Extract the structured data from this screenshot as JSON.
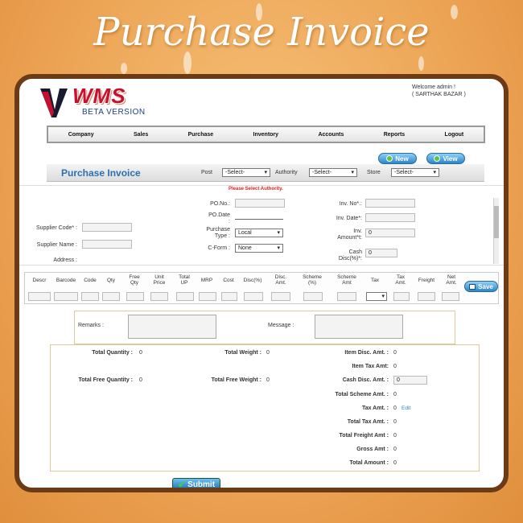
{
  "banner": {
    "title": "Purchase Invoice"
  },
  "header": {
    "logo_text": "WMS",
    "logo_sub": "BETA VERSION",
    "welcome_line1": "Welcome admin !",
    "welcome_line2": "( SARTHAK BAZAR )"
  },
  "nav": [
    "Company",
    "Sales",
    "Purchase",
    "Inventory",
    "Accounts",
    "Reports",
    "Logout"
  ],
  "toolbar": {
    "new_label": "New",
    "view_label": "View"
  },
  "filters": {
    "page_title": "Purchase Invoice",
    "post_label": "Post",
    "post_value": "-Select-",
    "authority_label": "Authority",
    "authority_value": "-Select-",
    "store_label": "Store",
    "store_value": "-Select-"
  },
  "form": {
    "warning": "Please Select Authority.",
    "supplier_code_label": "Supplier Code* :",
    "supplier_name_label": "Supplier Name :",
    "address_label": "Address :",
    "po_no_label": "PO.No.:",
    "po_date_label1": "PO.Date",
    "po_date_label2": ":",
    "purchase_type_label1": "Purchase",
    "purchase_type_label2": "Type :",
    "purchase_type_value": "Local",
    "cform_label": "C-Form :",
    "cform_value": "None",
    "inv_no_label": "Inv. No*.:",
    "inv_date_label": "Inv. Date*:",
    "inv_amount_label1": "Inv.",
    "inv_amount_label2": "Amount*t:",
    "inv_amount_value": "0",
    "cash_disc_label1": "Cash",
    "cash_disc_label2": "Disc(%)*:",
    "cash_disc_value": "0"
  },
  "grid": {
    "columns": [
      "Descr",
      "Barcode",
      "Code",
      "Qty",
      "Free\nQty",
      "Unit\nPrice",
      "Total\nUP",
      "MRP",
      "Cost",
      "Disc(%)",
      "Disc.\nAmt.",
      "Scheme\n(%)",
      "Scheme\nAmt",
      "Tax",
      "Tax\nAmt.",
      "Freight",
      "Net\nAmt."
    ],
    "save_label": "Save"
  },
  "notes": {
    "remarks_label": "Remarks :",
    "message_label": "Message :"
  },
  "totals": {
    "total_quantity_label": "Total Quantity :",
    "total_quantity": "0",
    "total_weight_label": "Total Weight :",
    "total_weight": "0",
    "item_disc_label": "Item Disc. Amt. :",
    "item_disc": "0",
    "item_tax_label": "Item Tax Amt:",
    "item_tax": "0",
    "total_free_qty_label": "Total Free Quantity :",
    "total_free_qty": "0",
    "total_free_weight_label": "Total Free Weight :",
    "total_free_weight": "0",
    "cash_disc_label": "Cash Disc. Amt. :",
    "cash_disc": "0",
    "total_scheme_label": "Total Scheme Amt. :",
    "total_scheme": "0",
    "tax_amt_label": "Tax Amt. :",
    "tax_amt": "0",
    "edit_label": "Edit",
    "total_tax_label": "Total Tax Amt. :",
    "total_tax": "0",
    "total_freight_label": "Total Freight Amt :",
    "total_freight": "0",
    "gross_label": "Gross Amt :",
    "gross": "0",
    "total_amount_label": "Total Amount :",
    "total_amount": "0"
  },
  "footer": {
    "submit_label": "Submit"
  }
}
